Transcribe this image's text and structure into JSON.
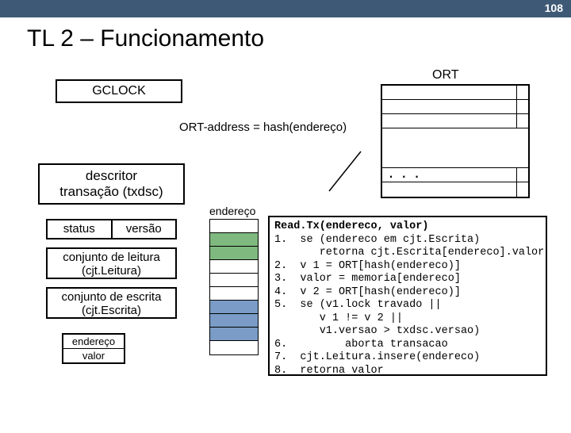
{
  "page_number": "108",
  "title": "TL 2 – Funcionamento",
  "gclock": "GCLOCK",
  "ort_label": "ORT",
  "formula": "ORT-address = hash(endereço)",
  "ort_dots": ". . .",
  "descriptor": {
    "line1": "descritor",
    "line2": "transação (txdsc)"
  },
  "status": "status",
  "versao": "versão",
  "leitura": {
    "l1": "conjunto de leitura",
    "l2": "(cjt.Leitura)"
  },
  "escrita": {
    "l1": "conjunto de escrita",
    "l2": "(cjt.Escrita)"
  },
  "ev": {
    "endereco": "endereço",
    "valor": "valor"
  },
  "mem_label": "endereço",
  "code": {
    "sig": "Read.Tx(endereco, valor)",
    "l1": "1.  se (endereco em cjt.Escrita)",
    "l1b": "       retorna cjt.Escrita[endereco].valor",
    "l2": "2.  v 1 = ORT[hash(endereco)]",
    "l3": "3.  valor = memoria[endereco]",
    "l4": "4.  v 2 = ORT[hash(endereco)]",
    "l5": "5.  se (v1.lock travado ||",
    "l5b": "       v 1 != v 2 ||",
    "l5c": "       v1.versao > txdsc.versao)",
    "l6": "6.         aborta transacao",
    "l7": "7.  cjt.Leitura.insere(endereco)",
    "l8": "8.  retorna valor"
  }
}
